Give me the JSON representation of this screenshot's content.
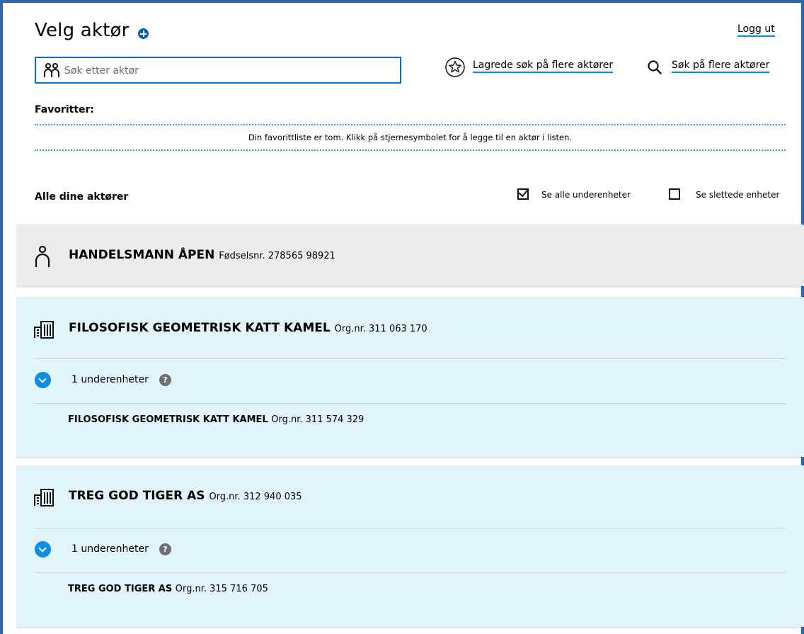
{
  "header": {
    "title": "Velg aktør",
    "logout_label": "Logg ut",
    "search_placeholder": "Søk etter aktør",
    "saved_search_label": "Lagrede søk på flere aktører",
    "multi_search_label": "Søk på flere aktører"
  },
  "favorites": {
    "title": "Favoritter:",
    "empty_message": "Din favorittliste er tom. Klikk på stjernesymbolet for å legge til en aktør i listen."
  },
  "actors": {
    "title": "Alle dine aktører",
    "show_all_subunits": {
      "label": "Se alle underenheter",
      "checked": true
    },
    "show_deleted_units": {
      "label": "Se slettede enheter",
      "checked": false
    }
  },
  "entries": [
    {
      "type": "person",
      "name": "HANDELSMANN ÅPEN",
      "id_text": "Fødselsnr. 278565 98921",
      "icon": "person-icon"
    },
    {
      "type": "organization",
      "name": "FILOSOFISK GEOMETRISK KATT KAMEL",
      "id_text": "Org.nr. 311 063 170",
      "icon": "building-icon",
      "subunits_label": "1 underenheter",
      "subunits": [
        {
          "name": "FILOSOFISK GEOMETRISK KATT KAMEL",
          "id_text": "Org.nr. 311 574 329"
        }
      ]
    },
    {
      "type": "organization",
      "name": "TREG GOD TIGER AS",
      "id_text": "Org.nr. 312 940 035",
      "icon": "building-icon",
      "subunits_label": "1 underenheter",
      "subunits": [
        {
          "name": "TREG GOD TIGER AS",
          "id_text": "Org.nr. 315 716 705"
        }
      ]
    }
  ],
  "help_glyph": "?",
  "colors": {
    "accent": "#0062ba",
    "link_underline": "#008fd6",
    "frame": "#2f66b3",
    "org_card_bg": "#e2f4fb",
    "person_card_bg": "#ececec"
  }
}
